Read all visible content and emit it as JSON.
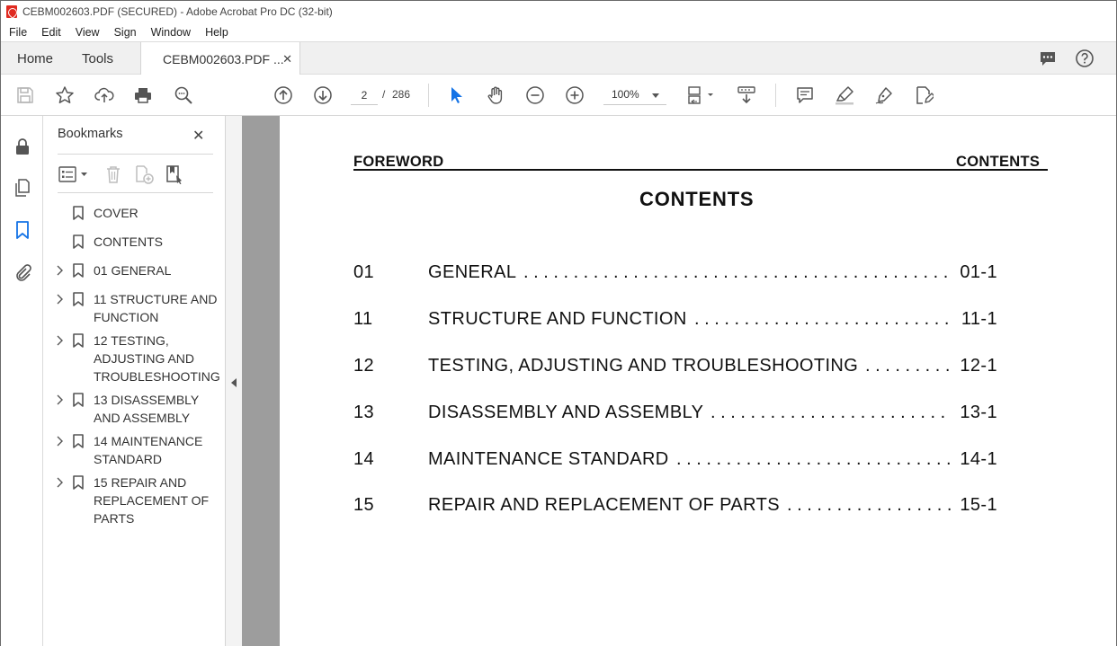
{
  "window": {
    "title": "CEBM002603.PDF (SECURED) - Adobe Acrobat Pro DC (32-bit)"
  },
  "menu": [
    "File",
    "Edit",
    "View",
    "Sign",
    "Window",
    "Help"
  ],
  "tabs": {
    "home": "Home",
    "tools": "Tools",
    "document": "CEBM002603.PDF ...",
    "close_glyph": "✕"
  },
  "toolbar": {
    "current_page": "2",
    "page_separator": "/",
    "total_pages": "286",
    "zoom": "100%",
    "accent_color": "#1473e6"
  },
  "bookmarks": {
    "title": "Bookmarks",
    "close_glyph": "✕",
    "items": [
      {
        "label": "COVER",
        "expandable": false
      },
      {
        "label": "CONTENTS",
        "expandable": false
      },
      {
        "label": "01  GENERAL",
        "expandable": true
      },
      {
        "label": "11 STRUCTURE AND FUNCTION",
        "expandable": true
      },
      {
        "label": "12  TESTING, ADJUSTING AND TROUBLESHOOTING",
        "expandable": true
      },
      {
        "label": "13  DISASSEMBLY AND ASSEMBLY",
        "expandable": true
      },
      {
        "label": "14  MAINTENANCE STANDARD",
        "expandable": true
      },
      {
        "label": "15 REPAIR AND REPLACEMENT OF PARTS",
        "expandable": true
      }
    ]
  },
  "document": {
    "header_left": "FOREWORD",
    "header_right": "CONTENTS",
    "title": "CONTENTS",
    "toc": [
      {
        "num": "01",
        "title": "GENERAL",
        "page": "01-1"
      },
      {
        "num": "11",
        "title": "STRUCTURE AND FUNCTION",
        "page": "11-1"
      },
      {
        "num": "12",
        "title": "TESTING, ADJUSTING AND TROUBLESHOOTING",
        "page": "12-1"
      },
      {
        "num": "13",
        "title": "DISASSEMBLY AND ASSEMBLY",
        "page": "13-1"
      },
      {
        "num": "14",
        "title": "MAINTENANCE STANDARD",
        "page": "14-1"
      },
      {
        "num": "15",
        "title": "REPAIR AND REPLACEMENT OF PARTS",
        "page": "15-1"
      }
    ]
  }
}
